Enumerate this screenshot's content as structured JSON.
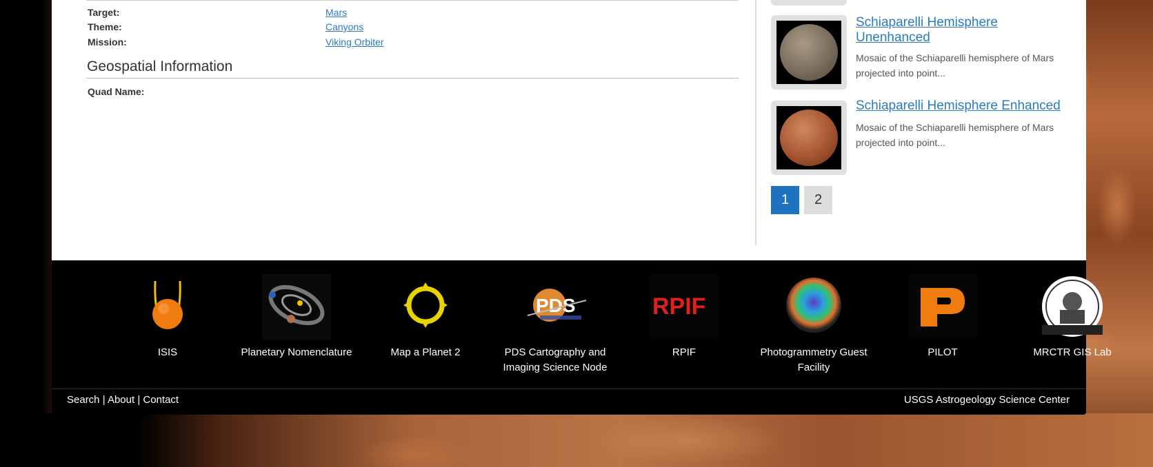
{
  "metadata": {
    "target_label": "Target:",
    "target_value": "Mars",
    "theme_label": "Theme:",
    "theme_value": "Canyons",
    "mission_label": "Mission:",
    "mission_value": "Viking Orbiter"
  },
  "geospatial": {
    "title": "Geospatial Information",
    "quad_label": "Quad Name:"
  },
  "related": {
    "items": [
      {
        "title": "Schiaparelli Hemisphere Unenhanced",
        "description": "Mosaic of the Schiaparelli hemisphere of Mars projected into point...",
        "thumb_icon": "mars-gray-globe-image"
      },
      {
        "title": "Schiaparelli Hemisphere Enhanced",
        "description": "Mosaic of the Schiaparelli hemisphere of Mars projected into point...",
        "thumb_icon": "mars-red-globe-image"
      }
    ],
    "pages": [
      "1",
      "2"
    ],
    "active_page": "1"
  },
  "footer": {
    "tools": [
      {
        "label": "ISIS",
        "icon": "isis-logo"
      },
      {
        "label": "Planetary Nomenclature",
        "icon": "solar-system-logo"
      },
      {
        "label": "Map a Planet 2",
        "icon": "map-a-planet-logo"
      },
      {
        "label": "PDS Cartography and Imaging Science Node",
        "icon": "pds-logo"
      },
      {
        "label": "RPIF",
        "icon": "rpif-logo"
      },
      {
        "label": "Photogrammetry Guest Facility",
        "icon": "photogrammetry-logo"
      },
      {
        "label": "PILOT",
        "icon": "pilot-logo"
      },
      {
        "label": "MRCTR GIS Lab",
        "icon": "mrctr-logo"
      }
    ],
    "links": {
      "search": "Search",
      "about": "About",
      "contact": "Contact",
      "separator": "|"
    },
    "org": "USGS Astrogeology Science Center"
  },
  "colors": {
    "link": "#2a7ac0",
    "active_page": "#1e73be",
    "footer_bg": "#000000"
  }
}
